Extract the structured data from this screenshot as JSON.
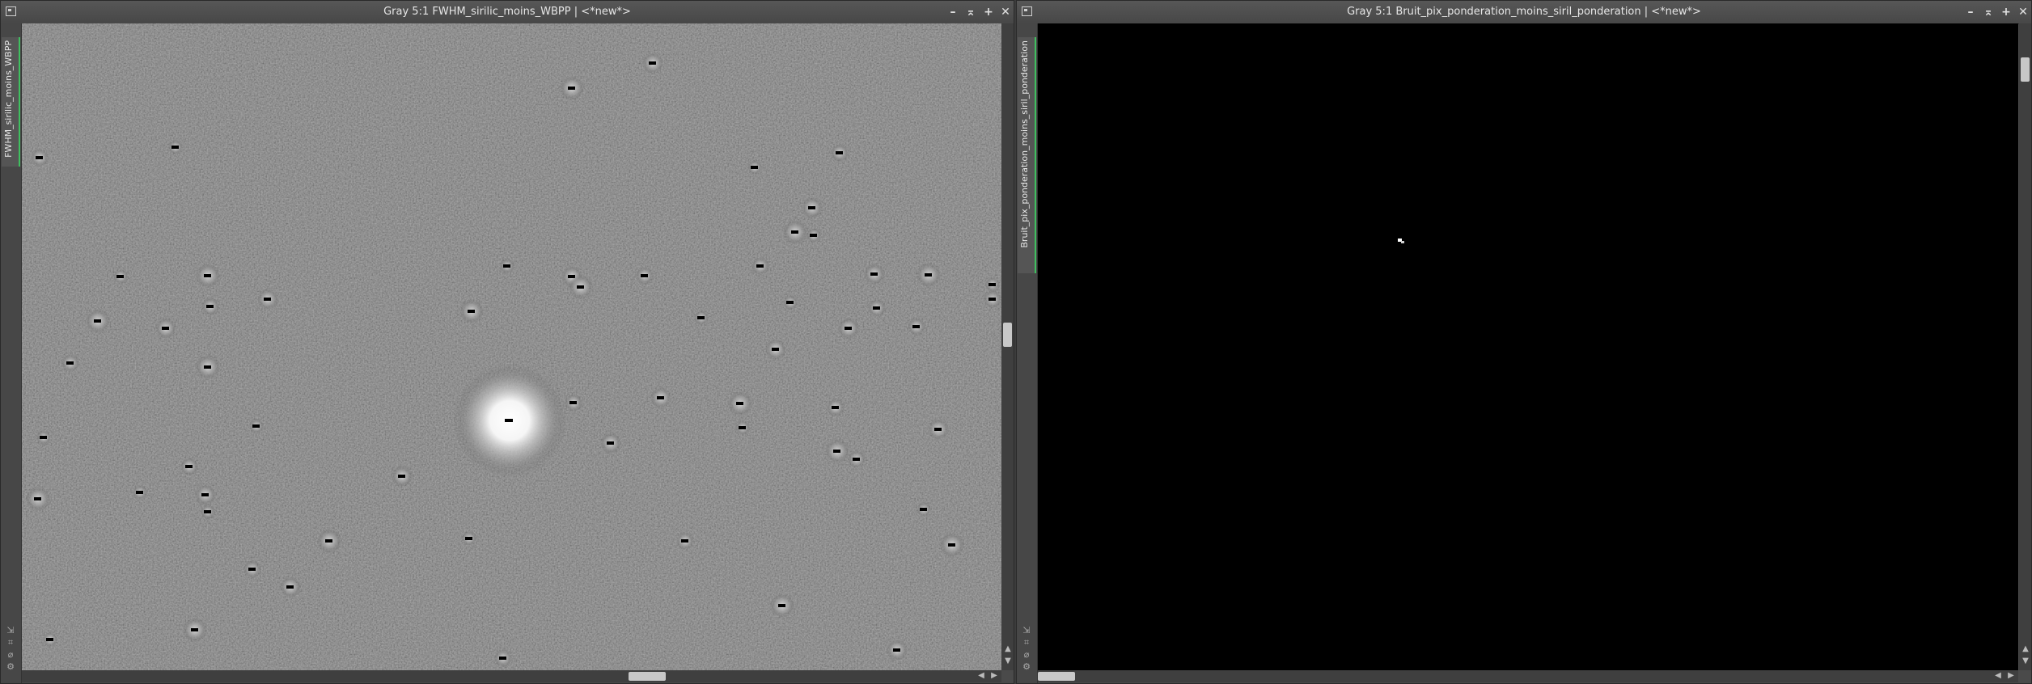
{
  "windows": {
    "left": {
      "title": "Gray 5:1 FWHM_sirilic_moins_WBPP | <*new*>",
      "tab_label": "FWHM_sirilic_moins_WBPP"
    },
    "right": {
      "title": "Gray 5:1 Bruit_pix_ponderation_moins_siril_ponderation | <*new*>",
      "tab_label": "Bruit_pix_ponderation_moins_siril_ponderation"
    }
  },
  "controls": {
    "minimize": "–",
    "shade": "⌅",
    "maximize": "+",
    "close": "✕"
  },
  "icons": {
    "window": "window-icon",
    "side": [
      "pin-icon",
      "fit-icon",
      "link-icon",
      "settings-icon"
    ]
  },
  "colors": {
    "title_bar": "#4c4c4c",
    "tab_accent": "#3fbf5f",
    "image_left_bg": "#5b5b5b",
    "image_right_bg": "#000000"
  }
}
